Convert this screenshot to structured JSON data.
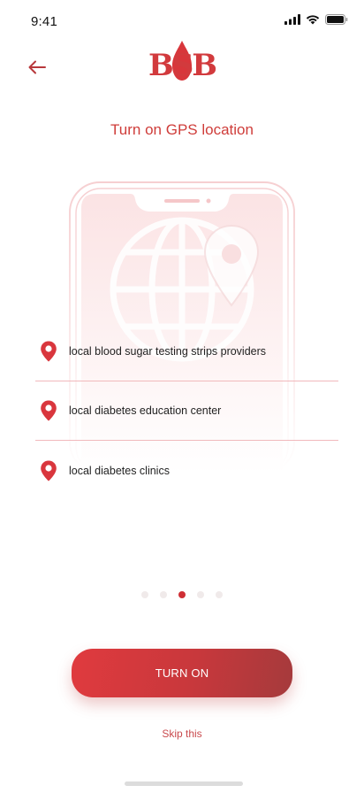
{
  "status_bar": {
    "time": "9:41",
    "icons": [
      "signal-icon",
      "wifi-icon",
      "battery-icon"
    ]
  },
  "header": {
    "back_icon": "arrow-left-icon",
    "logo_text": "BSB"
  },
  "page": {
    "title": "Turn on GPS location"
  },
  "illustration": {
    "icon": "globe-location-icon"
  },
  "locations": [
    {
      "icon": "map-pin-icon",
      "label": "local blood sugar testing strips providers"
    },
    {
      "icon": "map-pin-icon",
      "label": "local diabetes education center"
    },
    {
      "icon": "map-pin-icon",
      "label": "local diabetes clinics"
    }
  ],
  "pager": {
    "total": 5,
    "active_index": 2
  },
  "actions": {
    "turn_on_label": "TURN ON",
    "skip_label": "Skip this"
  },
  "colors": {
    "accent": "#cf3d3a",
    "pin": "#d9363d",
    "divider": "#f1b9bc"
  }
}
